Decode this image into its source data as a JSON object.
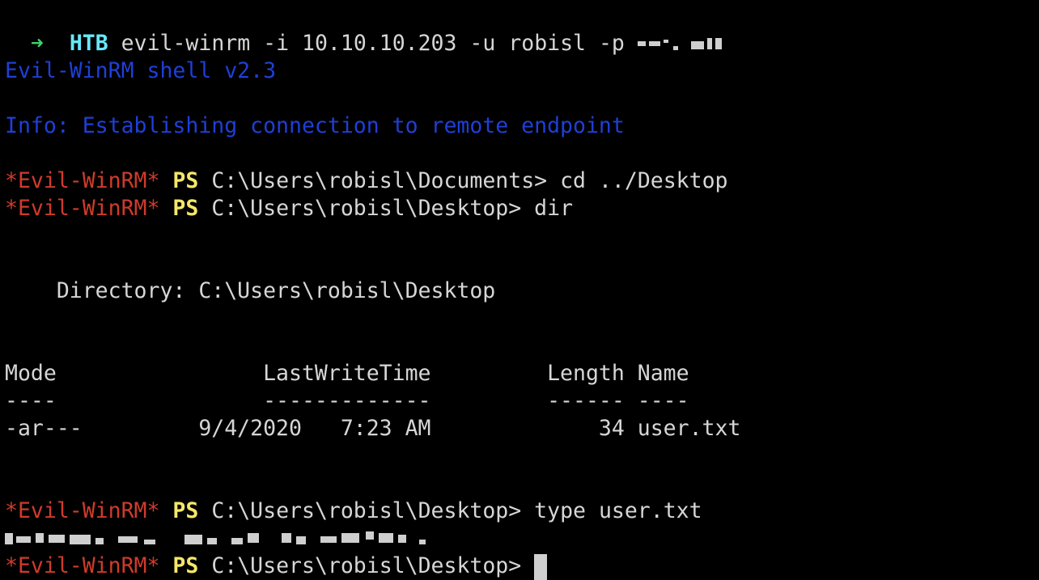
{
  "terminal": {
    "prompt": {
      "arrow": "➜",
      "dir": "HTB",
      "command": "evil-winrm -i 10.10.10.203 -u robisl -p"
    },
    "banner": "Evil-WinRM shell v2.3",
    "info": "Info: Establishing connection to remote endpoint",
    "shell_name": "*Evil-WinRM*",
    "ps_label": "PS",
    "lines": [
      {
        "path": "C:\\Users\\robisl\\Documents>",
        "input": " cd ../Desktop"
      },
      {
        "path": "C:\\Users\\robisl\\Desktop>",
        "input": " dir"
      },
      {
        "path": "C:\\Users\\robisl\\Desktop>",
        "input": " type user.txt"
      },
      {
        "path": "C:\\Users\\robisl\\Desktop>",
        "input": " "
      }
    ],
    "directory_label": "    Directory: C:\\Users\\robisl\\Desktop",
    "table": {
      "header": "Mode                LastWriteTime         Length Name",
      "underline": "----                -------------         ------ ----",
      "rows": [
        "-ar---         9/4/2020   7:23 AM             34 user.txt"
      ]
    },
    "colors": {
      "background": "#000000",
      "prompt_arrow": "#3fd16b",
      "prompt_dir": "#67e8f9",
      "banner_blue": "#1f3fd8",
      "shell_red": "#cf3b2b",
      "ps_yellow": "#f4e76a",
      "text": "#d6d6d6"
    }
  }
}
